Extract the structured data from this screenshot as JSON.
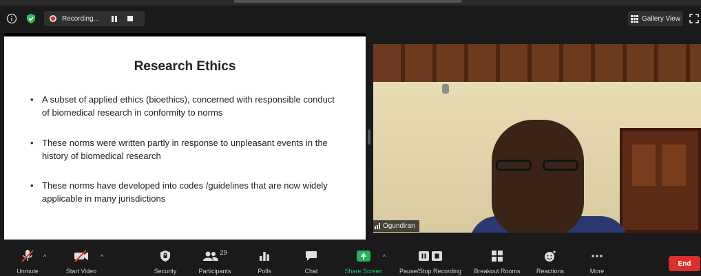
{
  "top_bar": {
    "recording_label": "Recording...",
    "gallery_view_label": "Gallery View"
  },
  "slide": {
    "title": "Research Ethics",
    "bullets": [
      "A subset of applied ethics (bioethics),  concerned with responsible conduct of biomedical research in conformity to norms",
      "These norms were written partly in response to unpleasant events in the history of biomedical research",
      "These norms have developed into codes /guidelines that are now widely applicable in many jurisdictions"
    ],
    "bullet_char": "•"
  },
  "video": {
    "participant_name": "Ogundiran"
  },
  "toolbar": {
    "unmute": "Unmute",
    "start_video": "Start Video",
    "security": "Security",
    "participants": "Participants",
    "participants_count": "29",
    "polls": "Polls",
    "chat": "Chat",
    "share_screen": "Share Screen",
    "pause_stop_recording": "Pause/Stop Recording",
    "breakout_rooms": "Breakout Rooms",
    "reactions": "Reactions",
    "more": "More",
    "end": "End",
    "caret": "^"
  },
  "colors": {
    "share_green": "#23b35b",
    "end_red": "#d9302f",
    "recording_red": "#e02828"
  }
}
